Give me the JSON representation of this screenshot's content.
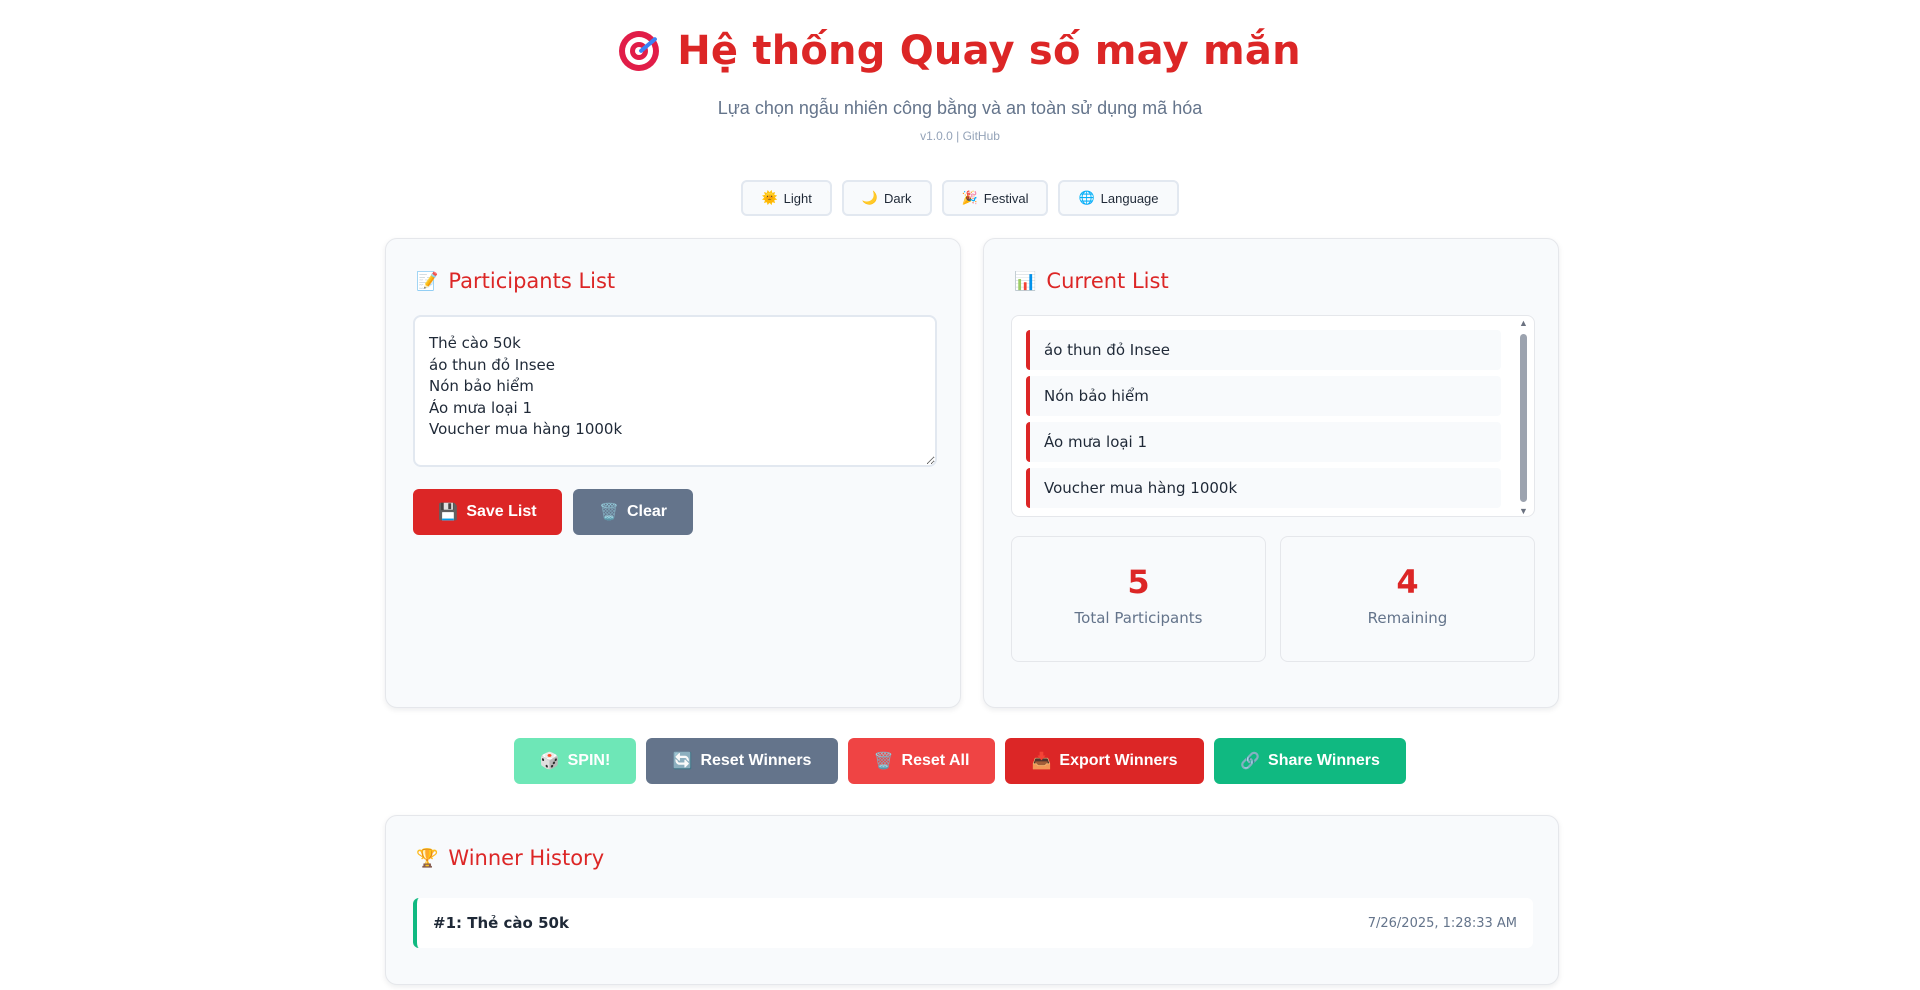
{
  "header": {
    "title": "Hệ thống Quay số may mắn",
    "subtitle": "Lựa chọn ngẫu nhiên công bằng và an toàn sử dụng mã hóa",
    "version": "v1.0.0",
    "version_sep": " | ",
    "github": "GitHub",
    "title_icon": "target-icon"
  },
  "themes": [
    {
      "icon": "🌞",
      "label": "Light"
    },
    {
      "icon": "🌙",
      "label": "Dark"
    },
    {
      "icon": "🎉",
      "label": "Festival"
    },
    {
      "icon": "🌐",
      "label": "Language"
    }
  ],
  "participants": {
    "title_icon": "📝",
    "title": "Participants List",
    "textarea_value": "Thẻ cào 50k\náo thun đỏ Insee\nNón bảo hiểm\nÁo mưa loại 1\nVoucher mua hàng 1000k",
    "save_icon": "💾",
    "save_label": "Save List",
    "clear_icon": "🗑️",
    "clear_label": "Clear"
  },
  "current": {
    "title_icon": "📊",
    "title": "Current List",
    "items": [
      "áo thun đỏ Insee",
      "Nón bảo hiểm",
      "Áo mưa loại 1",
      "Voucher mua hàng 1000k"
    ],
    "stats": {
      "total_value": "5",
      "total_label": "Total Participants",
      "remaining_value": "4",
      "remaining_label": "Remaining"
    }
  },
  "actions": {
    "spin_icon": "🎲",
    "spin_label": "SPIN!",
    "reset_winners_icon": "🔄",
    "reset_winners_label": "Reset Winners",
    "reset_all_icon": "🗑️",
    "reset_all_label": "Reset All",
    "export_icon": "📥",
    "export_label": "Export Winners",
    "share_icon": "🔗",
    "share_label": "Share Winners"
  },
  "history": {
    "title_icon": "🏆",
    "title": "Winner History",
    "entries": [
      {
        "name": "#1: Thẻ cào 50k",
        "time": "7/26/2025, 1:28:33 AM"
      }
    ]
  },
  "colors": {
    "primary": "#dc2626",
    "secondary": "#64748b",
    "success": "#10b981",
    "spin_disabled": "#6ee7b7"
  }
}
